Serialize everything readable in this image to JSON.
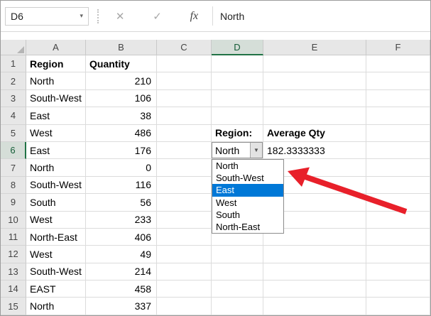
{
  "window": {
    "name_box": "D6",
    "formula_bar_value": "North"
  },
  "icons": {
    "namebox_dropdown": "▾",
    "cancel": "✕",
    "enter": "✓",
    "function": "fx",
    "combo_dropdown": "▼"
  },
  "colors": {
    "excel_green": "#217346",
    "selection_blue": "#0078d7",
    "arrow_red": "#e8202a"
  },
  "columns": [
    "A",
    "B",
    "C",
    "D",
    "E",
    "F"
  ],
  "rows": [
    "1",
    "2",
    "3",
    "4",
    "5",
    "6",
    "7",
    "8",
    "9",
    "10",
    "11",
    "12",
    "13",
    "14",
    "15"
  ],
  "table": {
    "regions": [
      "Region",
      "North",
      "South-West",
      "East",
      "West",
      "East",
      "North",
      "South-West",
      "South",
      "West",
      "North-East",
      "West",
      "South-West",
      "EAST",
      "North"
    ],
    "quantities": [
      "Quantity",
      "210",
      "106",
      "38",
      "486",
      "176",
      "0",
      "116",
      "56",
      "233",
      "406",
      "49",
      "214",
      "458",
      "337"
    ]
  },
  "panel": {
    "region_label": "Region:",
    "average_label": "Average Qty",
    "selected_region": "North",
    "average_value": "182.3333333"
  },
  "dropdown": {
    "items": [
      "North",
      "South-West",
      "East",
      "West",
      "South",
      "North-East"
    ],
    "highlighted_item": "East",
    "highlighted_index": 2
  }
}
